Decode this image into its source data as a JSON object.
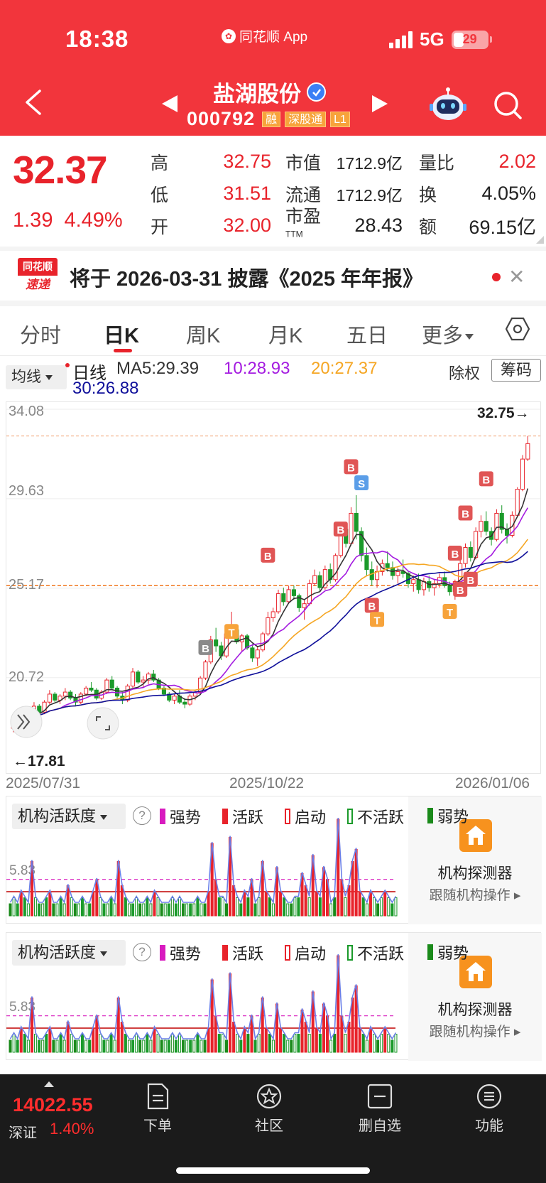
{
  "status_bar": {
    "time": "18:38",
    "app": "同花顺 App",
    "network": "5G",
    "battery": "29"
  },
  "header": {
    "stock_name": "盐湖股份",
    "stock_code": "000792",
    "tags": [
      "融",
      "深股通",
      "L1"
    ]
  },
  "quote": {
    "price": "32.37",
    "change": "1.39",
    "change_pct": "4.49%",
    "high_label": "高",
    "high": "32.75",
    "low_label": "低",
    "low": "31.51",
    "open_label": "开",
    "open": "32.00",
    "mktcap_label": "市值",
    "mktcap": "1712.9亿",
    "float_label": "流通",
    "float": "1712.9亿",
    "pe_label": "市盈",
    "pe_sup": "TTM",
    "pe": "28.43",
    "volratio_label": "量比",
    "volratio": "2.02",
    "turnover_label": "换",
    "turnover": "4.05%",
    "amount_label": "额",
    "amount": "69.15亿"
  },
  "notice": {
    "logo_top": "同花顺",
    "logo_bottom": "速递",
    "text": "将于 2026-03-31 披露《2025 年年报》"
  },
  "tabs": [
    "分时",
    "日K",
    "周K",
    "月K",
    "五日",
    "更多"
  ],
  "active_tab": "日K",
  "ma": {
    "selector": "均线",
    "line_label": "日线",
    "ma5": "MA5:29.39",
    "ma10": "10:28.93",
    "ma20": "20:27.37",
    "ma30": "30:26.88",
    "chuquan": "除权",
    "chouma": "筹码",
    "colors": {
      "ma5": "#333333",
      "ma10": "#a41be0",
      "ma20": "#f5a623",
      "ma30": "#0f0f9a"
    }
  },
  "chart_data": {
    "type": "candlestick",
    "y_ticks": [
      "34.08",
      "29.63",
      "25.17",
      "20.72"
    ],
    "x_ticks": [
      "2025/07/31",
      "2025/10/22",
      "2026/01/06"
    ],
    "ylim": [
      17.81,
      34.08
    ],
    "high_marker": "32.75→",
    "low_marker": "←17.81",
    "reference_level": 25.3,
    "signal_labels": [
      "B",
      "S",
      "T"
    ],
    "candles": [
      [
        18.2,
        18.6,
        18.0,
        18.5
      ],
      [
        18.5,
        18.9,
        18.3,
        18.7
      ],
      [
        18.7,
        18.8,
        18.4,
        18.5
      ],
      [
        18.5,
        19.2,
        18.4,
        19.1
      ],
      [
        19.1,
        19.5,
        18.9,
        19.3
      ],
      [
        19.3,
        19.4,
        18.9,
        19.0
      ],
      [
        19.0,
        19.6,
        18.9,
        19.5
      ],
      [
        19.5,
        20.1,
        19.4,
        19.9
      ],
      [
        19.9,
        20.0,
        19.5,
        19.6
      ],
      [
        19.6,
        19.9,
        19.4,
        19.8
      ],
      [
        19.8,
        20.2,
        19.6,
        20.0
      ],
      [
        20.0,
        20.1,
        19.6,
        19.7
      ],
      [
        19.7,
        19.9,
        19.3,
        19.5
      ],
      [
        19.5,
        20.0,
        19.4,
        19.9
      ],
      [
        19.9,
        20.3,
        19.8,
        20.2
      ],
      [
        20.2,
        20.5,
        20.0,
        20.1
      ],
      [
        20.1,
        20.2,
        19.6,
        19.7
      ],
      [
        19.7,
        20.1,
        19.6,
        20.0
      ],
      [
        20.0,
        20.7,
        19.9,
        20.6
      ],
      [
        20.6,
        20.8,
        20.1,
        20.2
      ],
      [
        20.2,
        20.3,
        19.7,
        19.8
      ],
      [
        19.8,
        20.0,
        19.4,
        19.6
      ],
      [
        19.6,
        20.4,
        19.5,
        20.3
      ],
      [
        20.3,
        21.2,
        20.2,
        21.0
      ],
      [
        21.0,
        21.1,
        20.4,
        20.5
      ],
      [
        20.5,
        20.8,
        20.2,
        20.6
      ],
      [
        20.6,
        21.0,
        20.4,
        20.9
      ],
      [
        20.9,
        21.1,
        20.5,
        20.6
      ],
      [
        20.6,
        20.7,
        20.1,
        20.2
      ],
      [
        20.2,
        20.3,
        19.8,
        19.9
      ],
      [
        19.9,
        20.0,
        19.5,
        19.6
      ],
      [
        19.6,
        19.9,
        19.4,
        19.8
      ],
      [
        19.8,
        20.1,
        19.4,
        19.5
      ],
      [
        19.5,
        19.7,
        19.2,
        19.4
      ],
      [
        19.4,
        19.9,
        19.3,
        19.8
      ],
      [
        19.8,
        20.1,
        19.6,
        20.0
      ],
      [
        20.0,
        20.8,
        19.9,
        20.7
      ],
      [
        20.7,
        21.6,
        20.6,
        21.5
      ],
      [
        21.5,
        22.8,
        21.4,
        22.6
      ],
      [
        22.6,
        23.2,
        22.0,
        22.3
      ],
      [
        22.3,
        22.5,
        21.6,
        21.8
      ],
      [
        21.8,
        23.0,
        21.7,
        22.9
      ],
      [
        22.9,
        24.0,
        22.8,
        23.1
      ],
      [
        23.1,
        23.3,
        22.4,
        22.5
      ],
      [
        22.5,
        22.9,
        22.0,
        22.8
      ],
      [
        22.8,
        22.9,
        22.1,
        22.2
      ],
      [
        22.2,
        22.4,
        21.5,
        21.7
      ],
      [
        21.7,
        22.3,
        21.3,
        22.1
      ],
      [
        22.1,
        23.0,
        22.0,
        22.9
      ],
      [
        22.9,
        24.0,
        22.8,
        23.7
      ],
      [
        23.7,
        24.2,
        23.5,
        24.0
      ],
      [
        24.0,
        25.1,
        23.9,
        24.9
      ],
      [
        24.9,
        25.2,
        24.3,
        24.5
      ],
      [
        24.5,
        25.3,
        24.4,
        25.1
      ],
      [
        25.1,
        25.3,
        24.6,
        24.8
      ],
      [
        24.8,
        24.9,
        24.0,
        24.2
      ],
      [
        24.2,
        24.6,
        23.6,
        24.4
      ],
      [
        24.4,
        25.6,
        24.3,
        25.4
      ],
      [
        25.4,
        26.1,
        25.3,
        25.8
      ],
      [
        25.8,
        26.0,
        25.0,
        25.2
      ],
      [
        25.2,
        26.3,
        25.1,
        26.1
      ],
      [
        26.1,
        26.4,
        25.4,
        25.6
      ],
      [
        25.6,
        26.9,
        25.5,
        26.8
      ],
      [
        26.8,
        28.3,
        26.7,
        28.1
      ],
      [
        28.1,
        28.4,
        27.2,
        27.4
      ],
      [
        27.4,
        29.2,
        27.3,
        28.9
      ],
      [
        28.9,
        29.8,
        27.6,
        28.0
      ],
      [
        28.0,
        28.2,
        26.5,
        26.8
      ],
      [
        26.8,
        27.2,
        25.8,
        26.1
      ],
      [
        26.1,
        26.5,
        25.3,
        25.6
      ],
      [
        25.6,
        26.3,
        25.2,
        26.0
      ],
      [
        26.0,
        26.6,
        25.8,
        26.4
      ],
      [
        26.4,
        27.0,
        26.0,
        26.2
      ],
      [
        26.2,
        26.5,
        25.6,
        25.8
      ],
      [
        25.8,
        26.2,
        25.4,
        26.0
      ],
      [
        26.0,
        26.6,
        25.7,
        25.9
      ],
      [
        25.9,
        26.0,
        25.2,
        25.4
      ],
      [
        25.4,
        25.8,
        25.0,
        25.6
      ],
      [
        25.6,
        25.9,
        24.9,
        25.1
      ],
      [
        25.1,
        25.7,
        24.8,
        25.5
      ],
      [
        25.5,
        25.8,
        25.0,
        25.2
      ],
      [
        25.2,
        25.6,
        24.8,
        25.4
      ],
      [
        25.4,
        25.9,
        25.2,
        25.7
      ],
      [
        25.7,
        26.0,
        25.2,
        25.3
      ],
      [
        25.3,
        25.5,
        24.8,
        25.0
      ],
      [
        25.0,
        25.6,
        24.6,
        25.5
      ],
      [
        25.5,
        26.6,
        25.4,
        26.4
      ],
      [
        26.4,
        27.4,
        26.2,
        27.2
      ],
      [
        27.2,
        27.5,
        26.5,
        26.7
      ],
      [
        26.7,
        28.2,
        26.6,
        28.0
      ],
      [
        28.0,
        28.8,
        27.7,
        28.5
      ],
      [
        28.5,
        29.0,
        27.8,
        28.0
      ],
      [
        28.0,
        28.2,
        27.3,
        27.6
      ],
      [
        27.6,
        29.1,
        27.5,
        28.9
      ],
      [
        28.9,
        29.3,
        27.9,
        28.1
      ],
      [
        28.1,
        28.4,
        27.4,
        27.8
      ],
      [
        27.8,
        29.0,
        27.7,
        28.8
      ],
      [
        28.8,
        30.2,
        28.7,
        30.1
      ],
      [
        30.1,
        31.8,
        30.0,
        31.6
      ],
      [
        31.6,
        32.75,
        31.5,
        32.37
      ]
    ]
  },
  "indicator": {
    "selector": "机构活跃度",
    "help": "?",
    "legend": [
      {
        "label": "强势",
        "color": "#d81bbf"
      },
      {
        "label": "活跃",
        "color": "#e8232b"
      },
      {
        "label": "启动",
        "color": "#e8232b"
      },
      {
        "label": "不活跃",
        "color": "#1a9a2a"
      },
      {
        "label": "弱势",
        "color": "#1a8a1a"
      }
    ],
    "level": "5.83",
    "detector_title": "机构探测器",
    "detector_sub": "跟随机构操作 ▸",
    "bars": [
      2,
      3,
      2,
      4,
      3,
      2,
      9,
      3,
      2,
      2,
      3,
      4,
      2,
      2,
      3,
      2,
      5,
      3,
      2,
      2,
      3,
      2,
      2,
      4,
      6,
      3,
      2,
      2,
      3,
      2,
      9,
      5,
      3,
      2,
      2,
      3,
      2,
      2,
      3,
      2,
      4,
      3,
      2,
      2,
      2,
      3,
      2,
      3,
      2,
      2,
      2,
      2,
      3,
      2,
      2,
      4,
      12,
      6,
      3,
      3,
      2,
      13,
      5,
      3,
      2,
      4,
      3,
      6,
      2,
      3,
      9,
      4,
      3,
      2,
      8,
      4,
      3,
      2,
      2,
      3,
      3,
      7,
      5,
      3,
      10,
      4,
      3,
      8,
      6,
      2,
      3,
      16,
      6,
      3,
      5,
      9,
      11,
      4,
      3,
      2,
      4,
      3,
      2,
      3,
      4,
      3,
      2,
      3
    ]
  },
  "bottom_bar": {
    "index_value": "14022.55",
    "index_name": "深证",
    "index_change": "1.40%",
    "items": [
      "下单",
      "社区",
      "删自选",
      "功能"
    ]
  }
}
